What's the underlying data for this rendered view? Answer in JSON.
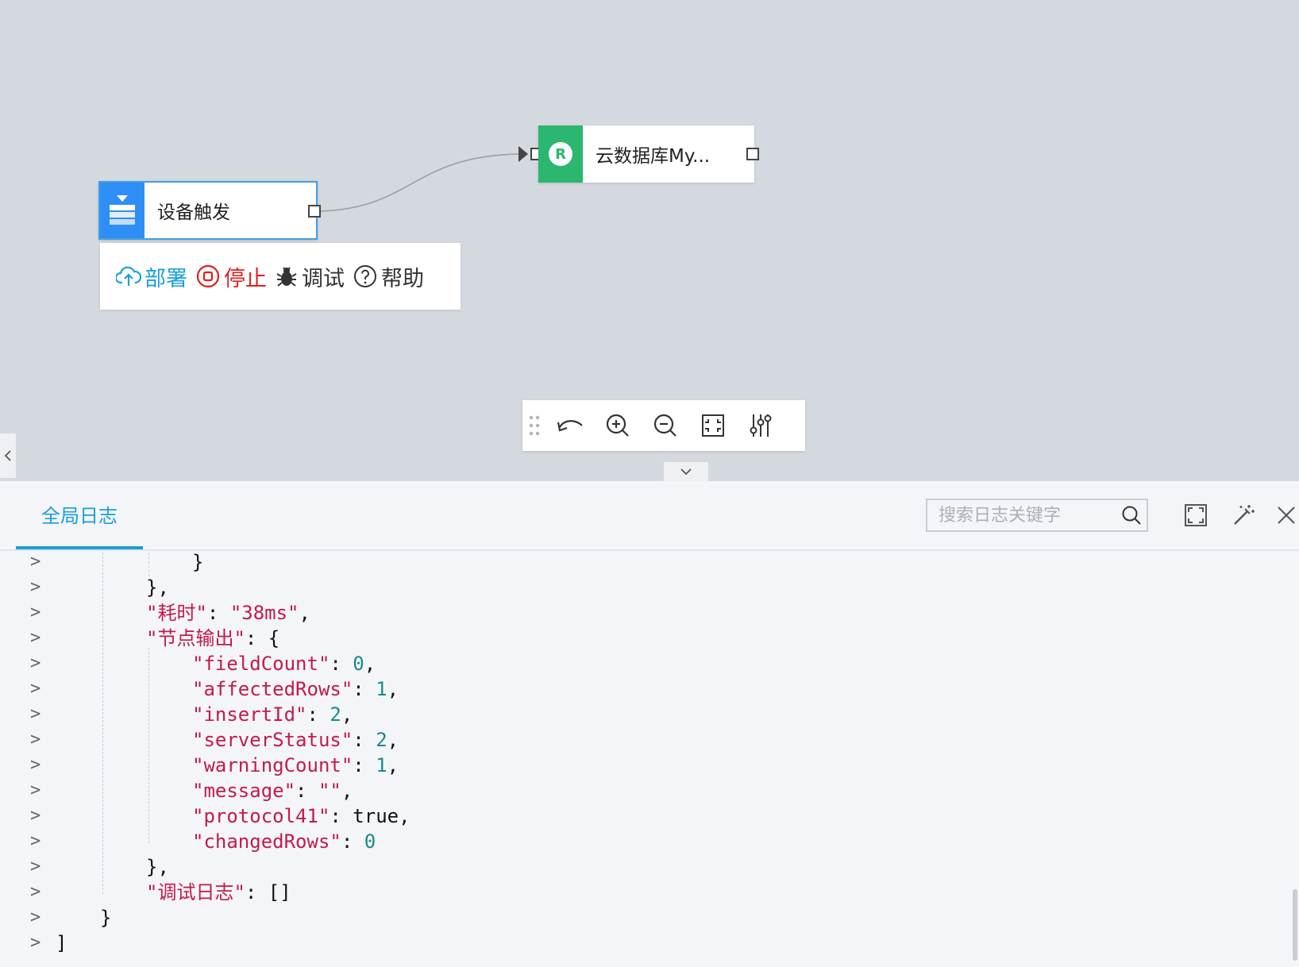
{
  "canvas": {
    "nodes": {
      "trigger": {
        "label": "设备触发",
        "icon": "list-icon"
      },
      "mysql": {
        "label": "云数据库My...",
        "icon_letter": "R"
      }
    },
    "actions": {
      "deploy": "部署",
      "stop": "停止",
      "debug": "调试",
      "help": "帮助"
    },
    "toolbar": {
      "icons": [
        "drag-handle-icon",
        "undo-icon",
        "zoom-in-icon",
        "zoom-out-icon",
        "fit-view-icon",
        "settings-sliders-icon"
      ]
    },
    "colors": {
      "trigger": "#2f8ef5",
      "mysql": "#2cb771",
      "deploy": "#1b9fd8",
      "stop": "#e02020"
    }
  },
  "log_panel": {
    "tab": "全局日志",
    "search_placeholder": "搜索日志关键字",
    "prompt": ">",
    "lines": [
      {
        "indent": 3,
        "tokens": [
          [
            "p",
            "}"
          ]
        ]
      },
      {
        "indent": 2,
        "tokens": [
          [
            "p",
            "},"
          ]
        ]
      },
      {
        "indent": 2,
        "tokens": [
          [
            "k",
            "\"耗时\""
          ],
          [
            "p",
            ": "
          ],
          [
            "s",
            "\"38ms\""
          ],
          [
            "p",
            ","
          ]
        ]
      },
      {
        "indent": 2,
        "tokens": [
          [
            "k",
            "\"节点输出\""
          ],
          [
            "p",
            ": {"
          ]
        ]
      },
      {
        "indent": 3,
        "tokens": [
          [
            "k",
            "\"fieldCount\""
          ],
          [
            "p",
            ": "
          ],
          [
            "n",
            "0"
          ],
          [
            "p",
            ","
          ]
        ]
      },
      {
        "indent": 3,
        "tokens": [
          [
            "k",
            "\"affectedRows\""
          ],
          [
            "p",
            ": "
          ],
          [
            "n",
            "1"
          ],
          [
            "p",
            ","
          ]
        ]
      },
      {
        "indent": 3,
        "tokens": [
          [
            "k",
            "\"insertId\""
          ],
          [
            "p",
            ": "
          ],
          [
            "n",
            "2"
          ],
          [
            "p",
            ","
          ]
        ]
      },
      {
        "indent": 3,
        "tokens": [
          [
            "k",
            "\"serverStatus\""
          ],
          [
            "p",
            ": "
          ],
          [
            "n",
            "2"
          ],
          [
            "p",
            ","
          ]
        ]
      },
      {
        "indent": 3,
        "tokens": [
          [
            "k",
            "\"warningCount\""
          ],
          [
            "p",
            ": "
          ],
          [
            "n",
            "1"
          ],
          [
            "p",
            ","
          ]
        ]
      },
      {
        "indent": 3,
        "tokens": [
          [
            "k",
            "\"message\""
          ],
          [
            "p",
            ": "
          ],
          [
            "s",
            "\"\""
          ],
          [
            "p",
            ","
          ]
        ]
      },
      {
        "indent": 3,
        "tokens": [
          [
            "k",
            "\"protocol41\""
          ],
          [
            "p",
            ": true,"
          ]
        ]
      },
      {
        "indent": 3,
        "tokens": [
          [
            "k",
            "\"changedRows\""
          ],
          [
            "p",
            ": "
          ],
          [
            "n",
            "0"
          ]
        ]
      },
      {
        "indent": 2,
        "tokens": [
          [
            "p",
            "},"
          ]
        ]
      },
      {
        "indent": 2,
        "tokens": [
          [
            "k",
            "\"调试日志\""
          ],
          [
            "p",
            ": []"
          ]
        ]
      },
      {
        "indent": 1,
        "tokens": [
          [
            "p",
            "}"
          ]
        ]
      },
      {
        "indent": 0,
        "tokens": [
          [
            "p",
            "]"
          ]
        ]
      }
    ]
  }
}
